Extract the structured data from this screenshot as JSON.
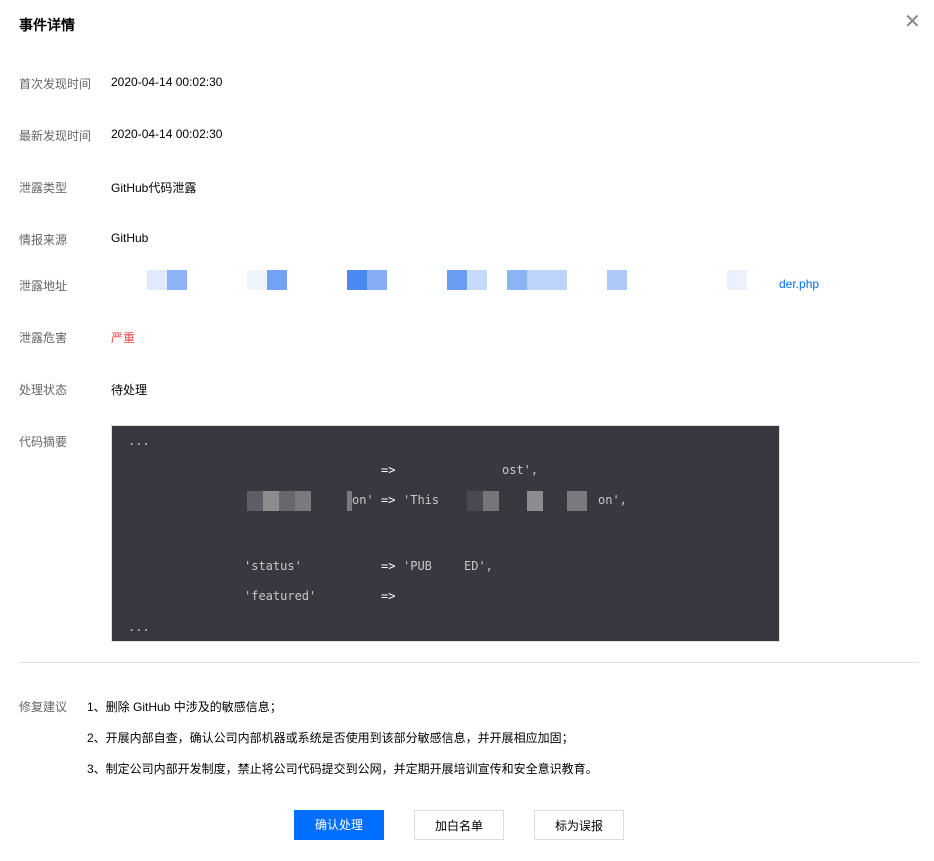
{
  "dialog": {
    "title": "事件详情",
    "close_icon": "close-icon"
  },
  "fields": [
    {
      "label": "首次发现时间",
      "value": "2020-04-14 00:02:30"
    },
    {
      "label": "最新发现时间",
      "value": "2020-04-14 00:02:30"
    },
    {
      "label": "泄露类型",
      "value": "GitHub代码泄露"
    },
    {
      "label": "情报来源",
      "value": "GitHub"
    },
    {
      "label": "泄露地址",
      "value": "der.php"
    },
    {
      "label": "泄露危害",
      "value": "严重"
    },
    {
      "label": "处理状态",
      "value": "待处理"
    },
    {
      "label": "代码摘要"
    }
  ],
  "code": {
    "ellipsis_top": "...",
    "l1_arrow": "=>",
    "l1_tail": "ost',",
    "l2_key": "on'",
    "l2_arrow": "=>",
    "l2_val": "'This",
    "l2_tail": "on',",
    "l3_key": "'status'",
    "l3_arrow": "=>",
    "l3_val": "'PUB",
    "l3_tail": "ED',",
    "l4_key": "'featured'",
    "l4_arrow": "=>",
    "ellipsis_bottom": "..."
  },
  "suggestions": {
    "label": "修复建议",
    "items": [
      "1、删除 GitHub 中涉及的敏感信息；",
      "2、开展内部自查，确认公司内部机器或系统是否使用到该部分敏感信息，并开展相应加固；",
      "3、制定公司内部开发制度，禁止将公司代码提交到公网，并定期开展培训宣传和安全意识教育。"
    ]
  },
  "actions": {
    "confirm": "确认处理",
    "whitelist": "加白名单",
    "false_positive": "标为误报"
  },
  "colors": {
    "primary": "#006eff",
    "danger": "#e54545",
    "code_bg": "#393841"
  }
}
